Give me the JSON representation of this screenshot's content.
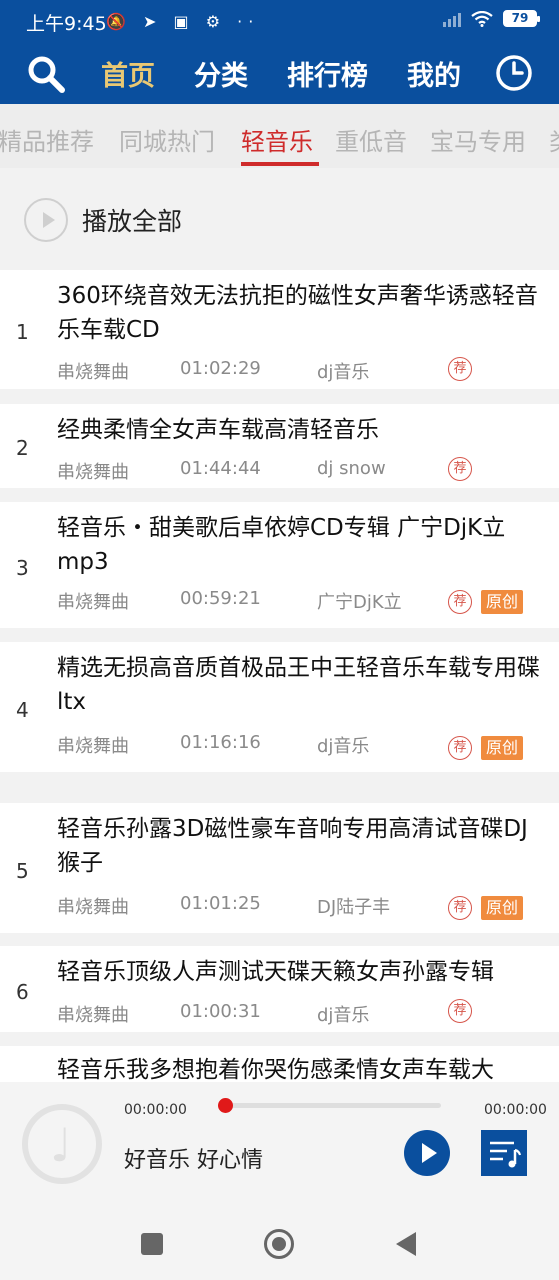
{
  "status_bar": {
    "time": "上午9:45",
    "icons": [
      "mute-icon",
      "telegram-icon",
      "app-icon",
      "gear-icon",
      "more-icon"
    ],
    "battery": "79"
  },
  "nav": {
    "tabs": [
      "首页",
      "分类",
      "排行榜",
      "我的"
    ],
    "active_tab": "首页",
    "accent_color": "#e9c874",
    "bg_color": "#0a4f9e"
  },
  "categories": {
    "items": [
      "精品推荐",
      "同城热门",
      "轻音乐",
      "重低音",
      "宝马专用",
      "类"
    ],
    "active": "轻音乐",
    "active_color": "#cf2b2b"
  },
  "play_all": {
    "label": "播放全部"
  },
  "songs": [
    {
      "index": "1",
      "title": "360环绕音效无法抗拒的磁性女声奢华诱惑轻音乐车载CD",
      "genre": "串烧舞曲",
      "duration": "01:02:29",
      "artist": "dj音乐",
      "rec": "荐",
      "original": ""
    },
    {
      "index": "2",
      "title": "经典柔情全女声车载高清轻音乐",
      "genre": "串烧舞曲",
      "duration": "01:44:44",
      "artist": "dj snow",
      "rec": "荐",
      "original": ""
    },
    {
      "index": "3",
      "title": "轻音乐・甜美歌后卓依婷CD专辑 广宁DjK立mp3",
      "genre": "串烧舞曲",
      "duration": "00:59:21",
      "artist": "广宁DjK立",
      "rec": "荐",
      "original": "原创"
    },
    {
      "index": "4",
      "title": "精选无损高音质首极品王中王轻音乐车载专用碟 ltx",
      "genre": "串烧舞曲",
      "duration": "01:16:16",
      "artist": "dj音乐",
      "rec": "荐",
      "original": "原创"
    },
    {
      "index": "5",
      "title": "轻音乐孙露3D磁性豪车音响专用高清试音碟DJ猴子",
      "genre": "串烧舞曲",
      "duration": "01:01:25",
      "artist": "DJ陆子丰",
      "rec": "荐",
      "original": "原创"
    },
    {
      "index": "6",
      "title": "轻音乐顶级人声测试天碟天籁女声孙露专辑",
      "genre": "串烧舞曲",
      "duration": "01:00:31",
      "artist": "dj音乐",
      "rec": "荐",
      "original": ""
    },
    {
      "index": "",
      "title": "轻音乐我多想抱着你哭伤感柔情女声车载大",
      "genre": "",
      "duration": "",
      "artist": "",
      "rec": "",
      "original": ""
    }
  ],
  "player": {
    "current_time": "00:00:00",
    "total_time": "00:00:00",
    "progress": 0,
    "title": "好音乐 好心情"
  }
}
